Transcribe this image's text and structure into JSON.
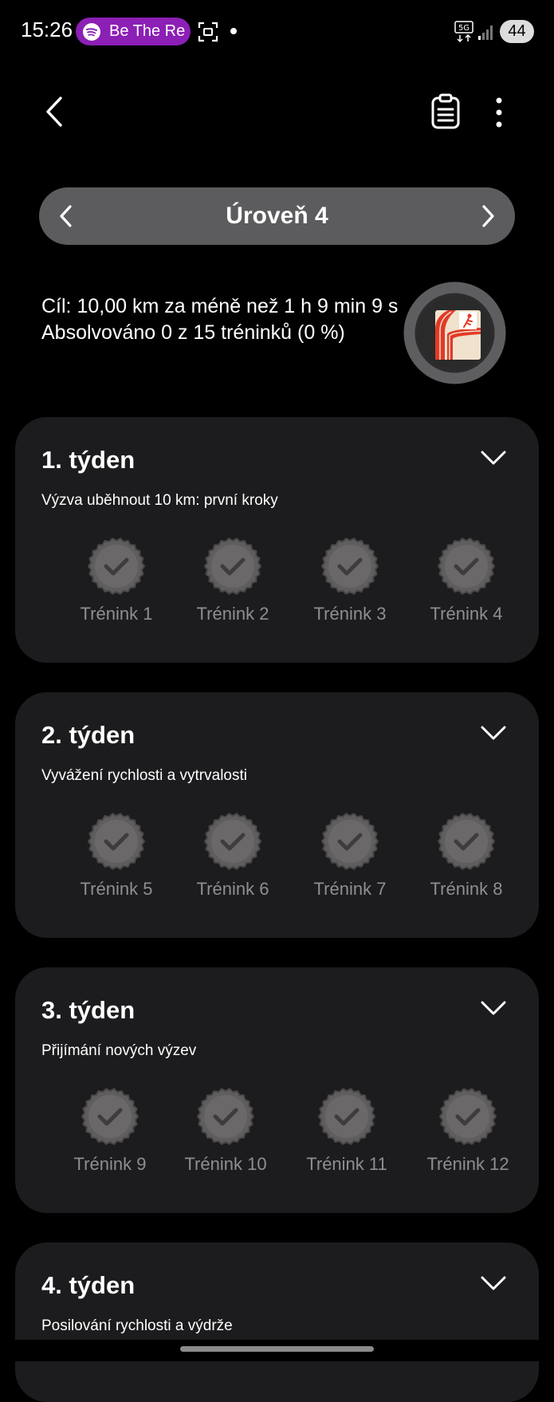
{
  "status_bar": {
    "time": "15:26",
    "spotify_text": "Be The Re",
    "network": "5G",
    "battery": "44"
  },
  "level": {
    "title": "Úroveň 4"
  },
  "goal": {
    "text": "Cíl: 10,00 km za méně než 1 h 9 min 9 s",
    "progress": "Absolvováno 0 z 15 tréninků (0 %)"
  },
  "weeks": [
    {
      "title": "1. týden",
      "subtitle": "Výzva uběhnout 10 km: první kroky",
      "sessions": [
        "Trénink 1",
        "Trénink 2",
        "Trénink 3",
        "Trénink 4"
      ]
    },
    {
      "title": "2. týden",
      "subtitle": "Vyvážení rychlosti a vytrvalosti",
      "sessions": [
        "Trénink 5",
        "Trénink 6",
        "Trénink 7",
        "Trénink 8"
      ]
    },
    {
      "title": "3. týden",
      "subtitle": "Přijímání nových výzev",
      "sessions": [
        "Trénink 9",
        "Trénink 10",
        "Trénink 11",
        "Trénink 12"
      ]
    },
    {
      "title": "4. týden",
      "subtitle": "Posilování rychlosti a výdrže",
      "sessions": []
    }
  ],
  "icons": {
    "back": "back-arrow-icon",
    "clipboard": "clipboard-list-icon",
    "more": "more-vert-icon",
    "level_prev": "chevron-left-icon",
    "level_next": "chevron-right-icon",
    "expand": "chevron-down-icon",
    "session_seal": "check-seal-icon",
    "goal_badge": "running-track-badge"
  },
  "colors": {
    "background": "#000000",
    "card": "#1c1c1e",
    "level_pill": "#5c5c5e",
    "seal": "#5f5d5e",
    "session_label": "#8e8e93",
    "badge_accent": "#e23a26",
    "spotify": "#8c1fb5"
  }
}
